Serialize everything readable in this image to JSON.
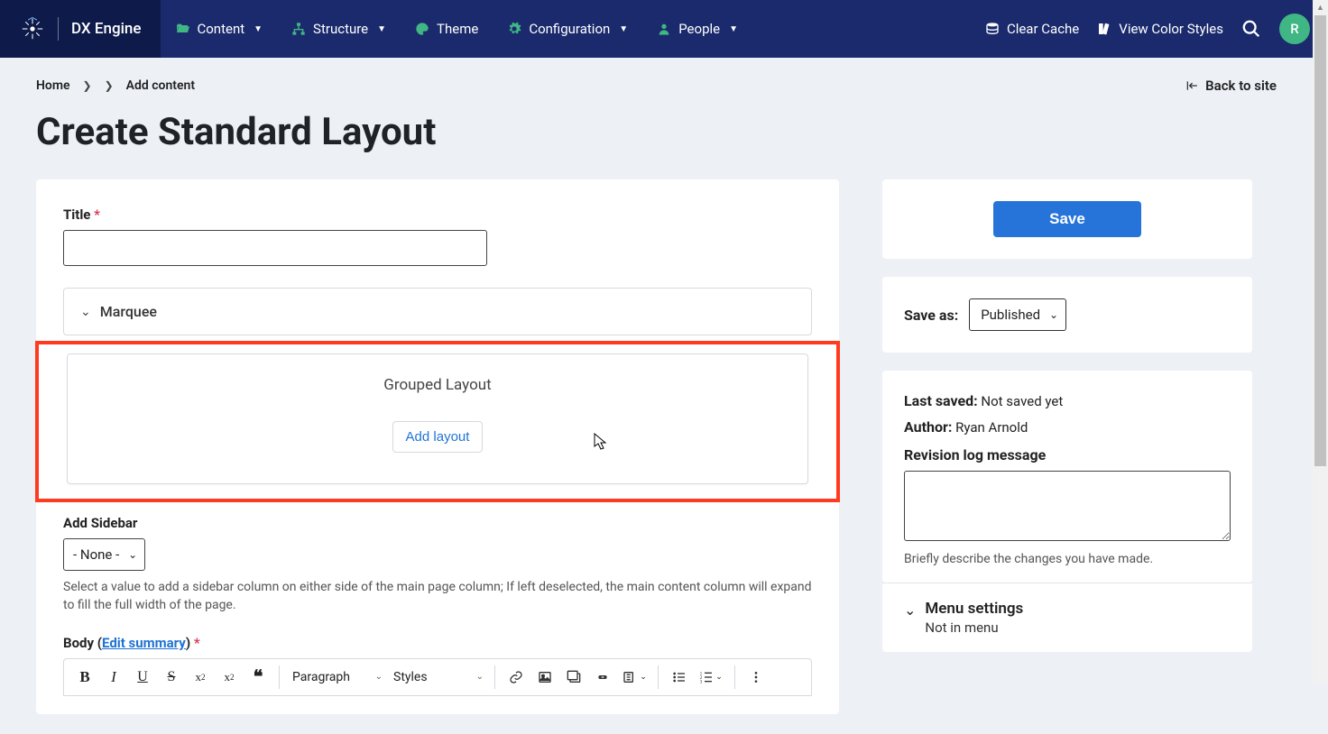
{
  "brand": {
    "name": "DX Engine"
  },
  "nav": {
    "items": [
      {
        "label": "Content"
      },
      {
        "label": "Structure"
      },
      {
        "label": "Theme"
      },
      {
        "label": "Configuration"
      },
      {
        "label": "People"
      }
    ]
  },
  "right_nav": {
    "clear_cache": "Clear Cache",
    "view_color": "View Color Styles",
    "avatar_initial": "R"
  },
  "breadcrumbs": {
    "home": "Home",
    "add_content": "Add content",
    "back_to_site": "Back to site"
  },
  "page_title": "Create Standard Layout",
  "form": {
    "title_label": "Title",
    "marquee_label": "Marquee",
    "grouped_layout_title": "Grouped Layout",
    "add_layout_btn": "Add layout",
    "add_sidebar_label": "Add Sidebar",
    "add_sidebar_value": "- None -",
    "add_sidebar_help": "Select a value to add a sidebar column on either side of the main page column; If left deselected, the main content column will expand to fill the full width of the page.",
    "body_label_prefix": "Body (",
    "edit_summary": "Edit summary",
    "body_label_suffix": ")"
  },
  "editor": {
    "para_label": "Paragraph",
    "styles_label": "Styles"
  },
  "save_card": {
    "save": "Save"
  },
  "saveas": {
    "label": "Save as:",
    "value": "Published"
  },
  "meta": {
    "last_saved_label": "Last saved:",
    "last_saved_value": "Not saved yet",
    "author_label": "Author:",
    "author_value": "Ryan Arnold",
    "revision_label": "Revision log message",
    "revision_help": "Briefly describe the changes you have made."
  },
  "menu": {
    "title": "Menu settings",
    "subtitle": "Not in menu"
  }
}
